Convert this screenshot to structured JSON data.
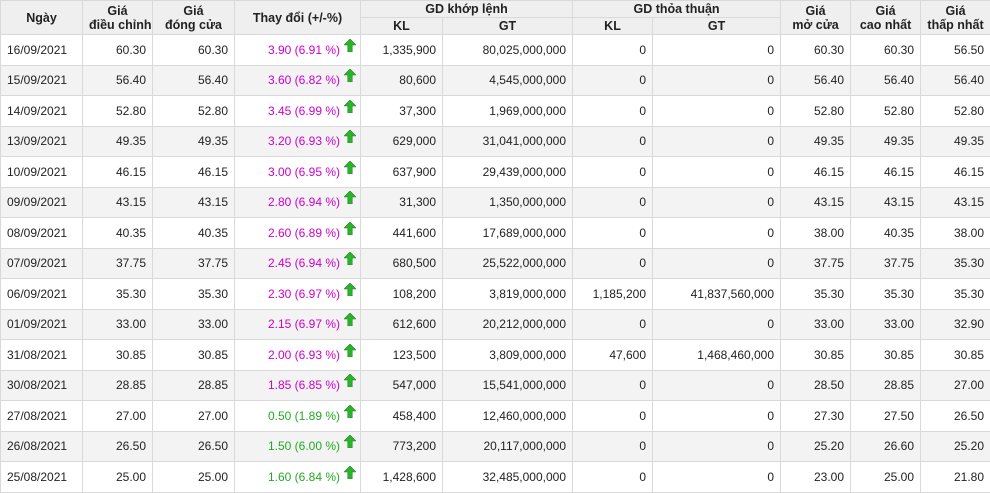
{
  "headers": {
    "date": "Ngày",
    "adj_line1": "Giá",
    "adj_line2": "điều chỉnh",
    "close_line1": "Giá",
    "close_line2": "đóng cửa",
    "change": "Thay đổi (+/-%)",
    "matched_group": "GD khớp lệnh",
    "matched_kl": "KL",
    "matched_gt": "GT",
    "agreed_group": "GD thỏa thuận",
    "agreed_kl": "KL",
    "agreed_gt": "GT",
    "open_line1": "Giá",
    "open_line2": "mở cửa",
    "high_line1": "Giá",
    "high_line2": "cao nhất",
    "low_line1": "Giá",
    "low_line2": "thấp nhất"
  },
  "colors": {
    "change_magenta": "#cc00cc",
    "change_green": "#22aa22",
    "up_arrow": "#2bb32b"
  },
  "rows": [
    {
      "date": "16/09/2021",
      "adj": "60.30",
      "close": "60.30",
      "change": "3.90 (6.91 %)",
      "change_color": "magenta",
      "arrow": "up-arrow-icon",
      "match_kl": "1,335,900",
      "match_gt": "80,025,000,000",
      "agree_kl": "0",
      "agree_gt": "0",
      "open": "60.30",
      "high": "60.30",
      "low": "56.50"
    },
    {
      "date": "15/09/2021",
      "adj": "56.40",
      "close": "56.40",
      "change": "3.60 (6.82 %)",
      "change_color": "magenta",
      "arrow": "up-arrow-icon",
      "match_kl": "80,600",
      "match_gt": "4,545,000,000",
      "agree_kl": "0",
      "agree_gt": "0",
      "open": "56.40",
      "high": "56.40",
      "low": "56.40"
    },
    {
      "date": "14/09/2021",
      "adj": "52.80",
      "close": "52.80",
      "change": "3.45 (6.99 %)",
      "change_color": "magenta",
      "arrow": "up-arrow-icon",
      "match_kl": "37,300",
      "match_gt": "1,969,000,000",
      "agree_kl": "0",
      "agree_gt": "0",
      "open": "52.80",
      "high": "52.80",
      "low": "52.80"
    },
    {
      "date": "13/09/2021",
      "adj": "49.35",
      "close": "49.35",
      "change": "3.20 (6.93 %)",
      "change_color": "magenta",
      "arrow": "up-arrow-icon",
      "match_kl": "629,000",
      "match_gt": "31,041,000,000",
      "agree_kl": "0",
      "agree_gt": "0",
      "open": "49.35",
      "high": "49.35",
      "low": "49.35"
    },
    {
      "date": "10/09/2021",
      "adj": "46.15",
      "close": "46.15",
      "change": "3.00 (6.95 %)",
      "change_color": "magenta",
      "arrow": "up-arrow-icon",
      "match_kl": "637,900",
      "match_gt": "29,439,000,000",
      "agree_kl": "0",
      "agree_gt": "0",
      "open": "46.15",
      "high": "46.15",
      "low": "46.15"
    },
    {
      "date": "09/09/2021",
      "adj": "43.15",
      "close": "43.15",
      "change": "2.80 (6.94 %)",
      "change_color": "magenta",
      "arrow": "up-arrow-icon",
      "match_kl": "31,300",
      "match_gt": "1,350,000,000",
      "agree_kl": "0",
      "agree_gt": "0",
      "open": "43.15",
      "high": "43.15",
      "low": "43.15"
    },
    {
      "date": "08/09/2021",
      "adj": "40.35",
      "close": "40.35",
      "change": "2.60 (6.89 %)",
      "change_color": "magenta",
      "arrow": "up-arrow-icon",
      "match_kl": "441,600",
      "match_gt": "17,689,000,000",
      "agree_kl": "0",
      "agree_gt": "0",
      "open": "38.00",
      "high": "40.35",
      "low": "38.00"
    },
    {
      "date": "07/09/2021",
      "adj": "37.75",
      "close": "37.75",
      "change": "2.45 (6.94 %)",
      "change_color": "magenta",
      "arrow": "up-arrow-icon",
      "match_kl": "680,500",
      "match_gt": "25,522,000,000",
      "agree_kl": "0",
      "agree_gt": "0",
      "open": "37.75",
      "high": "37.75",
      "low": "35.30"
    },
    {
      "date": "06/09/2021",
      "adj": "35.30",
      "close": "35.30",
      "change": "2.30 (6.97 %)",
      "change_color": "magenta",
      "arrow": "up-arrow-icon",
      "match_kl": "108,200",
      "match_gt": "3,819,000,000",
      "agree_kl": "1,185,200",
      "agree_gt": "41,837,560,000",
      "open": "35.30",
      "high": "35.30",
      "low": "35.30"
    },
    {
      "date": "01/09/2021",
      "adj": "33.00",
      "close": "33.00",
      "change": "2.15 (6.97 %)",
      "change_color": "magenta",
      "arrow": "up-arrow-icon",
      "match_kl": "612,600",
      "match_gt": "20,212,000,000",
      "agree_kl": "0",
      "agree_gt": "0",
      "open": "33.00",
      "high": "33.00",
      "low": "32.90"
    },
    {
      "date": "31/08/2021",
      "adj": "30.85",
      "close": "30.85",
      "change": "2.00 (6.93 %)",
      "change_color": "magenta",
      "arrow": "up-arrow-icon",
      "match_kl": "123,500",
      "match_gt": "3,809,000,000",
      "agree_kl": "47,600",
      "agree_gt": "1,468,460,000",
      "open": "30.85",
      "high": "30.85",
      "low": "30.85"
    },
    {
      "date": "30/08/2021",
      "adj": "28.85",
      "close": "28.85",
      "change": "1.85 (6.85 %)",
      "change_color": "magenta",
      "arrow": "up-arrow-icon",
      "match_kl": "547,000",
      "match_gt": "15,541,000,000",
      "agree_kl": "0",
      "agree_gt": "0",
      "open": "28.50",
      "high": "28.85",
      "low": "27.00"
    },
    {
      "date": "27/08/2021",
      "adj": "27.00",
      "close": "27.00",
      "change": "0.50 (1.89 %)",
      "change_color": "green",
      "arrow": "up-arrow-icon",
      "match_kl": "458,400",
      "match_gt": "12,460,000,000",
      "agree_kl": "0",
      "agree_gt": "0",
      "open": "27.30",
      "high": "27.50",
      "low": "26.50"
    },
    {
      "date": "26/08/2021",
      "adj": "26.50",
      "close": "26.50",
      "change": "1.50 (6.00 %)",
      "change_color": "green",
      "arrow": "up-arrow-icon",
      "match_kl": "773,200",
      "match_gt": "20,117,000,000",
      "agree_kl": "0",
      "agree_gt": "0",
      "open": "25.20",
      "high": "26.60",
      "low": "25.20"
    },
    {
      "date": "25/08/2021",
      "adj": "25.00",
      "close": "25.00",
      "change": "1.60 (6.84 %)",
      "change_color": "green",
      "arrow": "up-arrow-icon",
      "match_kl": "1,428,600",
      "match_gt": "32,485,000,000",
      "agree_kl": "0",
      "agree_gt": "0",
      "open": "23.00",
      "high": "25.00",
      "low": "21.80"
    }
  ]
}
